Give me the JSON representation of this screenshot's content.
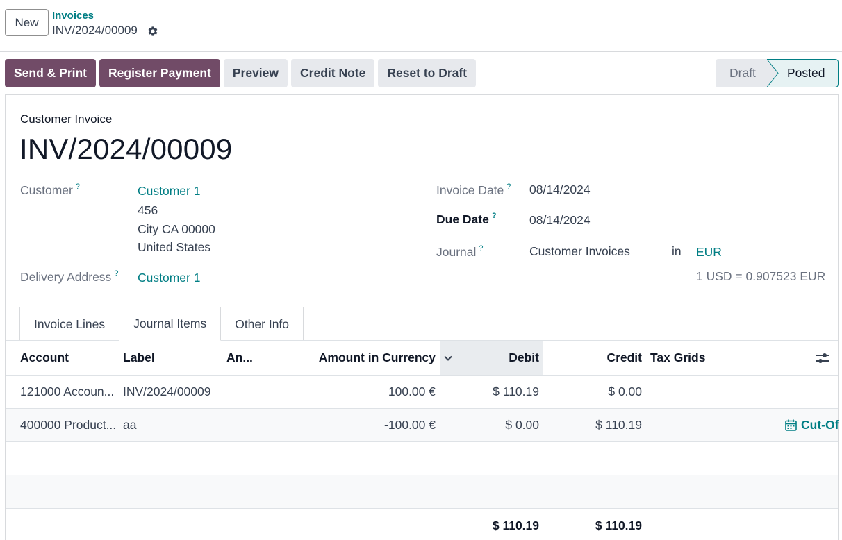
{
  "top": {
    "new_label": "New",
    "breadcrumb_parent": "Invoices",
    "breadcrumb_current": "INV/2024/00009"
  },
  "actions": [
    "Send & Print",
    "Register Payment",
    "Preview",
    "Credit Note",
    "Reset to Draft"
  ],
  "status": {
    "draft": "Draft",
    "posted": "Posted",
    "current": "Posted"
  },
  "form": {
    "doc_type": "Customer Invoice",
    "name": "INV/2024/00009",
    "customer_label": "Customer",
    "help_mark": "?",
    "customer_name": "Customer 1",
    "customer_addr1": "456",
    "customer_addr2": "City CA 00000",
    "customer_addr3": "United States",
    "delivery_label": "Delivery Address",
    "delivery_value": "Customer 1",
    "invoice_date_label": "Invoice Date",
    "invoice_date": "08/14/2024",
    "due_date_label": "Due Date",
    "due_date": "08/14/2024",
    "journal_label": "Journal",
    "journal_value": "Customer Invoices",
    "in_label": "in",
    "currency": "EUR",
    "rate": "1 USD = 0.907523 EUR"
  },
  "tabs": [
    {
      "label": "Invoice Lines",
      "active": false
    },
    {
      "label": "Journal Items",
      "active": true
    },
    {
      "label": "Other Info",
      "active": false
    }
  ],
  "table": {
    "columns": {
      "account": "Account",
      "label": "Label",
      "analytic": "An...",
      "amount_currency": "Amount in Currency",
      "debit": "Debit",
      "credit": "Credit",
      "tax_grids": "Tax Grids"
    },
    "rows": [
      {
        "account": "121000 Accoun...",
        "label": "INV/2024/00009",
        "amount_currency": "100.00 €",
        "debit": "$ 110.19",
        "credit": "$ 0.00",
        "extra": ""
      },
      {
        "account": "400000 Product...",
        "label": "aa",
        "amount_currency": "-100.00 €",
        "debit": "$ 0.00",
        "credit": "$ 110.19",
        "extra": "Cut-Of"
      }
    ],
    "totals": {
      "debit": "$ 110.19",
      "credit": "$ 110.19"
    }
  },
  "colors": {
    "primary": "#714b67",
    "link": "#017e84"
  }
}
